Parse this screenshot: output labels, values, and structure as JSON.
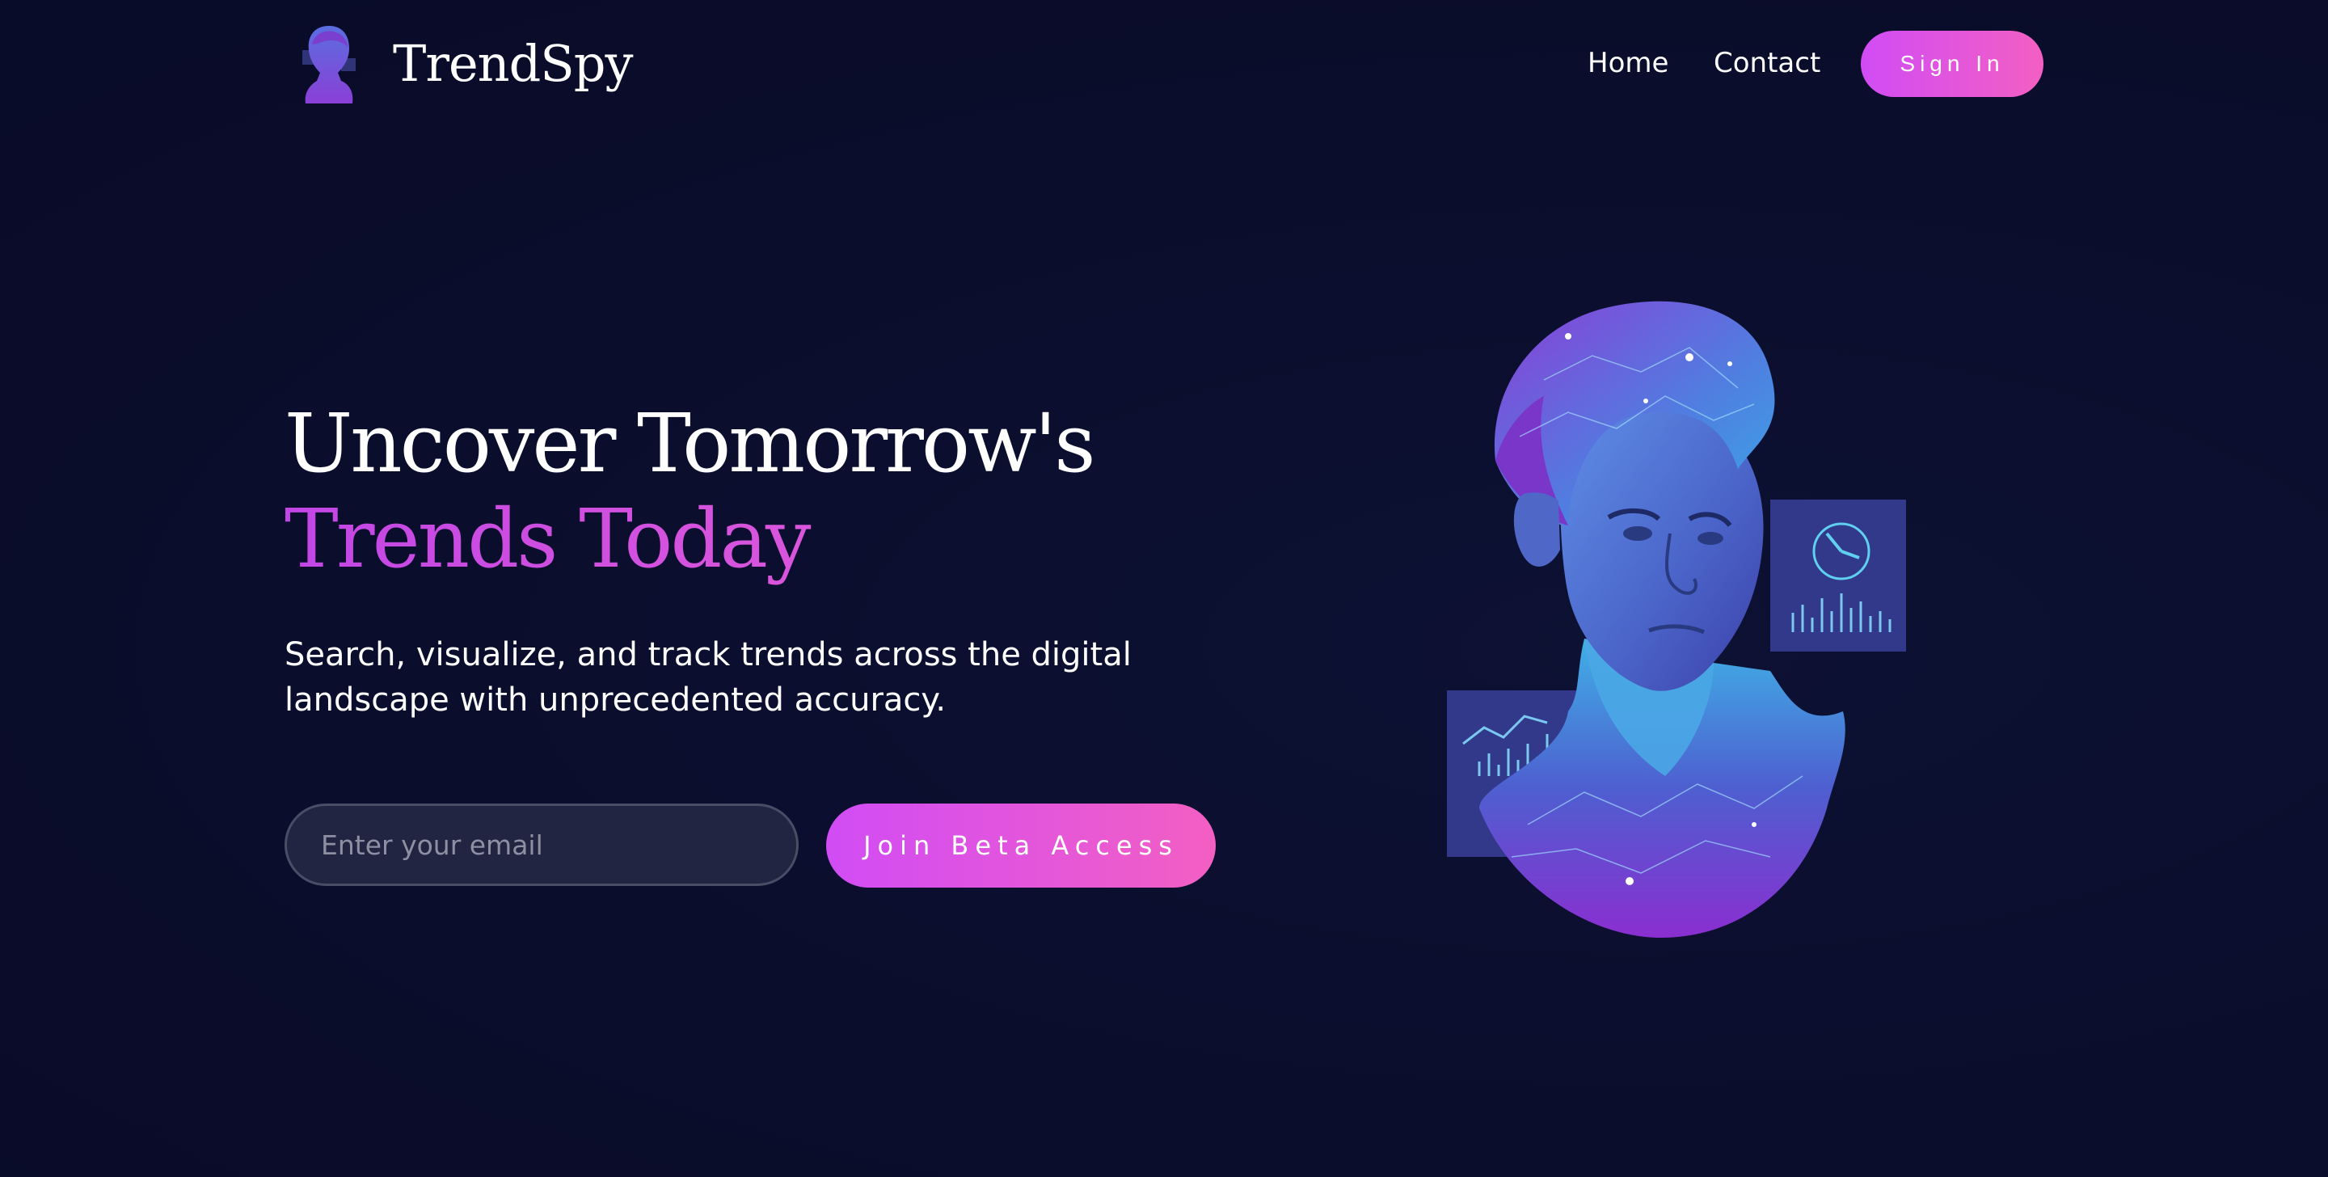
{
  "nav": {
    "brand": "TrendSpy",
    "logo_icon": "avatar-bust-icon",
    "links": [
      "Home",
      "Contact"
    ],
    "signin_label": "Sign In"
  },
  "hero": {
    "title_line1": "Uncover Tomorrow's",
    "title_line2": "Trends Today",
    "subtitle": "Search, visualize, and track trends across the digital landscape with unprecedented accuracy.",
    "email_placeholder": "Enter your email",
    "cta_label": "Join Beta Access",
    "illustration": "portrait-with-data-panels-illustration"
  },
  "colors": {
    "background": "#0a0d2b",
    "accent_start": "#d14cf5",
    "accent_end": "#f35fc3",
    "title_accent": "#c54ae8",
    "input_bg": "#222541",
    "input_border": "#4a4d66"
  }
}
